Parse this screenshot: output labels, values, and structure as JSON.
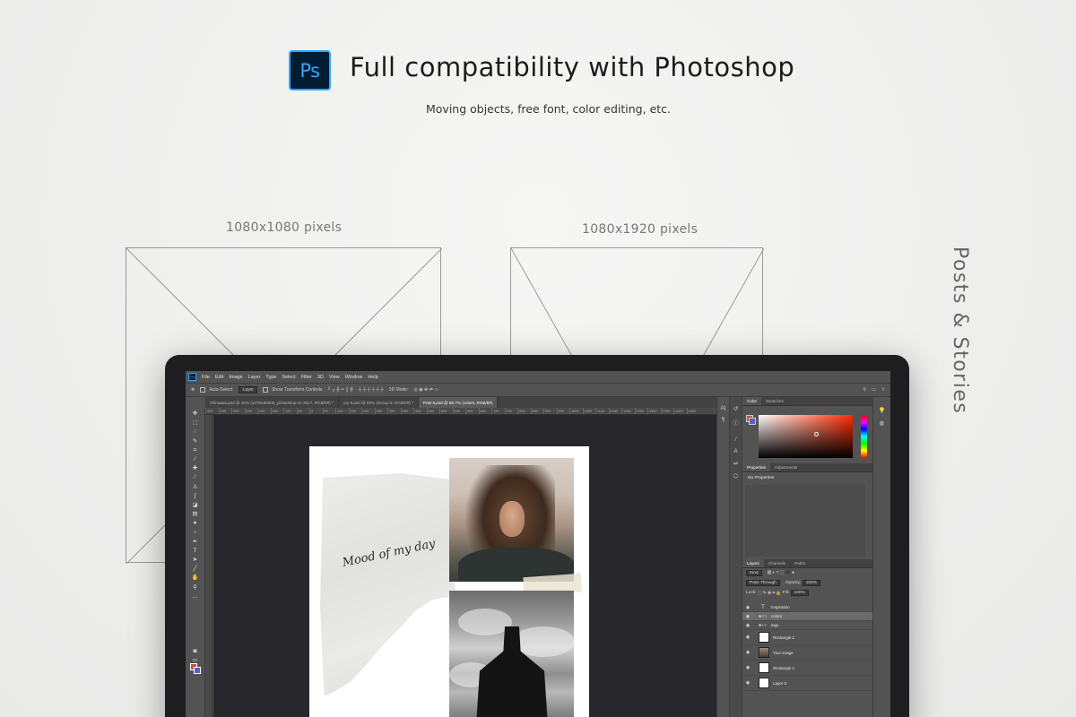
{
  "header": {
    "logo_text": "Ps",
    "title": "Full compatibility with Photoshop",
    "subtitle": "Moving objects, free font, color editing, etc."
  },
  "formats": {
    "square_label": "1080x1080 pixels",
    "story_label": "1080x1920 pixels",
    "side_label": "Posts & Stories"
  },
  "photoshop": {
    "app_icon": "Ps",
    "menu": [
      "File",
      "Edit",
      "Image",
      "Layer",
      "Type",
      "Select",
      "Filter",
      "3D",
      "View",
      "Window",
      "Help"
    ],
    "options": {
      "auto_select": "Auto-Select:",
      "auto_select_value": "Layer",
      "transform_controls": "Show Transform Controls",
      "mode_3d": "3D Mode:"
    },
    "tabs": [
      {
        "label": "Обложка.psd @ 25% (1478160600_photoshop-cc-2017, RGB/8#) *",
        "active": false
      },
      {
        "label": "crp 9.psd @ 50% (Group 5, RGB/8#) *",
        "active": false
      },
      {
        "label": "Post 6.psd @ 66.7% (colors, RGB/8#)",
        "active": true
      }
    ],
    "ruler_ticks": [
      "400",
      "350",
      "300",
      "250",
      "200",
      "150",
      "100",
      "50",
      "0",
      "50",
      "100",
      "150",
      "200",
      "250",
      "300",
      "350",
      "400",
      "450",
      "500",
      "550",
      "600",
      "650",
      "700",
      "750",
      "800",
      "850",
      "900",
      "950",
      "1000",
      "1050",
      "1100",
      "1150",
      "1200",
      "1250",
      "1300",
      "1350",
      "1400",
      "1450"
    ],
    "canvas_text": "Mood of my day",
    "color_panel": {
      "tabs": [
        "Color",
        "Swatches"
      ],
      "fg_color": "#b85a3c",
      "bg_color": "#5a5fd0"
    },
    "properties_panel": {
      "tabs": [
        "Properties",
        "Adjustments"
      ],
      "body": "No Properties"
    },
    "layers_panel": {
      "tabs": [
        "Layers",
        "Channels",
        "Paths"
      ],
      "kind_label": "Kind",
      "blend_mode": "Pass Through",
      "opacity_label": "Opacity:",
      "opacity_value": "100%",
      "lock_label": "Lock:",
      "fill_label": "Fill:",
      "fill_value": "100%",
      "layers": [
        {
          "name": "Inspiration",
          "type": "text"
        },
        {
          "name": "colors",
          "type": "folder",
          "selected": true
        },
        {
          "name": "logo",
          "type": "folder"
        },
        {
          "name": "Rectangle 2",
          "type": "shape"
        },
        {
          "name": "Your image",
          "type": "photo"
        },
        {
          "name": "Rectangle 1",
          "type": "shape"
        },
        {
          "name": "Layer 0",
          "type": "shape"
        }
      ]
    }
  }
}
